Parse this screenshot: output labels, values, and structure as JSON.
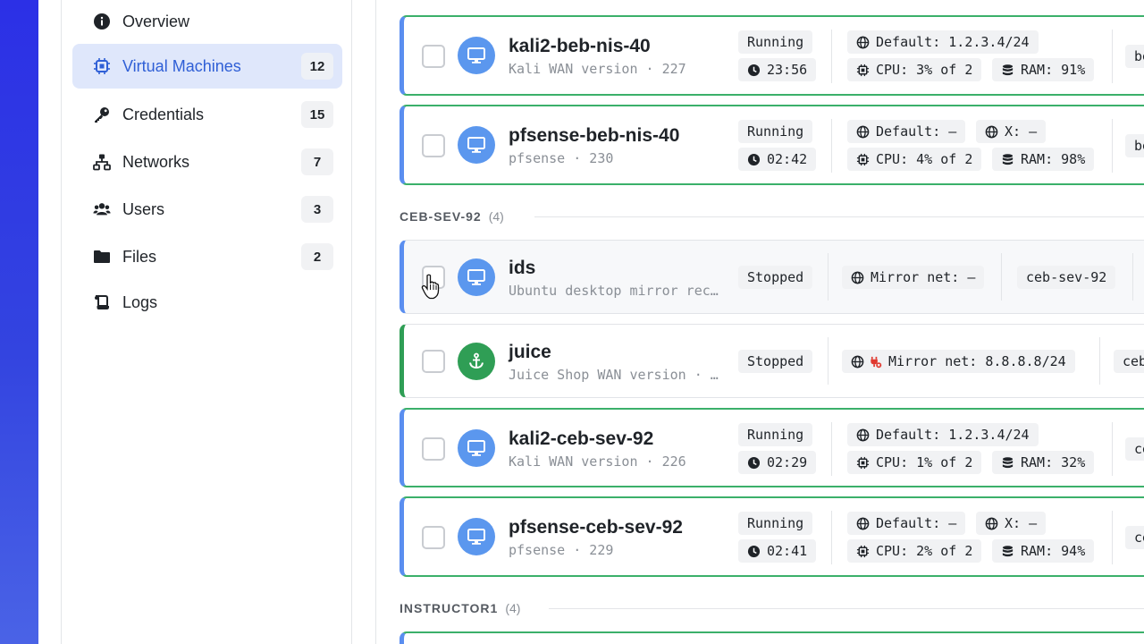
{
  "sidebar": {
    "items": [
      {
        "label": "Overview",
        "count": "",
        "icon": "info-icon",
        "active": false
      },
      {
        "label": "Virtual Machines",
        "count": "12",
        "icon": "chip-icon",
        "active": true
      },
      {
        "label": "Credentials",
        "count": "15",
        "icon": "key-icon",
        "active": false
      },
      {
        "label": "Networks",
        "count": "7",
        "icon": "network-icon",
        "active": false
      },
      {
        "label": "Users",
        "count": "3",
        "icon": "users-icon",
        "active": false
      },
      {
        "label": "Files",
        "count": "2",
        "icon": "folder-icon",
        "active": false
      },
      {
        "label": "Logs",
        "count": "",
        "icon": "scroll-icon",
        "active": false
      }
    ]
  },
  "groups": [
    {
      "name": "CEB-SEV-92",
      "count": "(4)"
    },
    {
      "name": "INSTRUCTOR1",
      "count": "(4)"
    }
  ],
  "vms": [
    {
      "name": "kali2-beb-nis-40",
      "subtitle": "Kali WAN version · 227",
      "status": "Running",
      "uptime": "23:56",
      "net1": "Default: 1.2.3.4/24",
      "net2": "",
      "cpu": "CPU: 3% of 2",
      "ram": "RAM: 91%",
      "tag": "be",
      "icon": "monitor-icon"
    },
    {
      "name": "pfsense-beb-nis-40",
      "subtitle": "pfsense · 230",
      "status": "Running",
      "uptime": "02:42",
      "net1": "Default: –",
      "net2": "X: –",
      "cpu": "CPU: 4% of 2",
      "ram": "RAM: 98%",
      "tag": "be",
      "icon": "monitor-icon"
    },
    {
      "name": "ids",
      "subtitle": "Ubuntu desktop mirror rec…",
      "status": "Stopped",
      "net1": "Mirror net: –",
      "tag": "ceb-sev-92",
      "icon": "monitor-icon"
    },
    {
      "name": "juice",
      "subtitle": "Juice Shop WAN version · …",
      "status": "Stopped",
      "net1": "Mirror net: 8.8.8.8/24",
      "tag": "ceb",
      "icon": "anchor-icon"
    },
    {
      "name": "kali2-ceb-sev-92",
      "subtitle": "Kali WAN version · 226",
      "status": "Running",
      "uptime": "02:29",
      "net1": "Default: 1.2.3.4/24",
      "net2": "",
      "cpu": "CPU: 1% of 2",
      "ram": "RAM: 32%",
      "tag": "ce",
      "icon": "monitor-icon"
    },
    {
      "name": "pfsense-ceb-sev-92",
      "subtitle": "pfsense · 229",
      "status": "Running",
      "uptime": "02:41",
      "net1": "Default: –",
      "net2": "X: –",
      "cpu": "CPU: 2% of 2",
      "ram": "RAM: 94%",
      "tag": "ce",
      "icon": "monitor-icon"
    }
  ],
  "colors": {
    "accent": "#2f5fd6",
    "running_border": "#3bb06a",
    "vm_avatar": "#5b97ee",
    "juice_avatar": "#2f9e55"
  }
}
